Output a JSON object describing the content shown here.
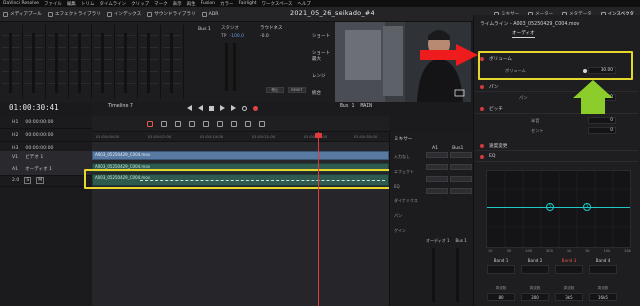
{
  "menubar": [
    "DaVinci Resolve",
    "ファイル",
    "編集",
    "トリム",
    "タイムライン",
    "クリップ",
    "マーク",
    "表示",
    "再生",
    "Fusion",
    "カラー",
    "Fairlight",
    "ワークスペース",
    "ヘルプ"
  ],
  "toolbar": {
    "items": [
      "メディアプール",
      "エフェクトライブラリ",
      "インデックス",
      "サウンドライブラリ",
      "ADR"
    ],
    "project_title": "2021_05_26_seikado_#4",
    "right_tabs": [
      "ミキサー",
      "メーター",
      "メタデータ",
      "インスペクタ"
    ]
  },
  "mixer_top": {
    "bus_label": "Bus 1",
    "eq_label": "スタジオ",
    "eq_value": "TP",
    "eq_num": "-100.0",
    "threshold_label": "ラウドネス",
    "th_value": "-0.0",
    "right_col": [
      "ショート",
      "ショート最大",
      "レンジ",
      "統合"
    ],
    "btns": [
      "停止",
      "RESET"
    ]
  },
  "timeline": {
    "timecode": "01:00:30:41",
    "name": "Timeline 7",
    "current_tc": "01:00:30:41",
    "bus": "Bus 1",
    "main": "MAIN",
    "ruler": [
      "01:00:00:00",
      "01:00:07:00",
      "01:00:14:00",
      "01:00:21:00",
      "01:00:28:00",
      "01:00:35:00"
    ],
    "tracks": [
      {
        "id": "H1",
        "time": "00:00:00:00"
      },
      {
        "id": "H2",
        "time": "00:00:00:00"
      },
      {
        "id": "H3",
        "time": "00:00:00:00"
      },
      {
        "id": "V1",
        "label": "ビデオ 1"
      },
      {
        "id": "A1",
        "label": "オーディオ 1"
      },
      {
        "id": "",
        "label": "",
        "vals": [
          "2.0",
          "S",
          "M"
        ]
      }
    ],
    "clips": {
      "video": "A003_05250429_C004.mov",
      "audio1": "A003_05250429_C004.mov",
      "audio2": "A003_05250429_C004.mov"
    }
  },
  "mixer2": {
    "title": "ミキサー",
    "cols": [
      "A1",
      "Bus1"
    ],
    "rows": [
      "入力なし",
      "エフェクト",
      "EQ",
      "ダイナミクス",
      "パン",
      "ゲイン"
    ],
    "sub_labels": [
      "オーディオ 1",
      "Bus 1"
    ]
  },
  "inspector": {
    "clip": "ライムライン - A003_05250429_C004.mov",
    "tab": "オーディオ",
    "volume_section": "ボリューム",
    "volume_label": "ボリューム",
    "volume_value": "30.00",
    "pan_section": "パン",
    "pan_label": "パン",
    "pan_value": "0",
    "pitch_section": "ピッチ",
    "pitch_labels": [
      "半音",
      "セント"
    ],
    "pitch_values": [
      "0",
      "0"
    ],
    "speed_section": "速度変更",
    "eq_section": "EQ",
    "eq_freqs": [
      "10",
      "30",
      "100",
      "300",
      "1k",
      "3k",
      "10k",
      "30k"
    ],
    "eq_handles": [
      "2",
      "3"
    ],
    "bands": [
      {
        "name": "Band 1",
        "value": "80"
      },
      {
        "name": "Band 2",
        "value": "300"
      },
      {
        "name": "Band 3",
        "value": "3k5"
      },
      {
        "name": "Band 4",
        "value": "16k5"
      }
    ],
    "band_label": "周波数",
    "colors": {
      "yellow_highlight": "#e7d62c",
      "red_arrow": "#ee1c1c",
      "green_arrow": "#8ccd2c",
      "eq_curve": "#22c7c7"
    }
  }
}
